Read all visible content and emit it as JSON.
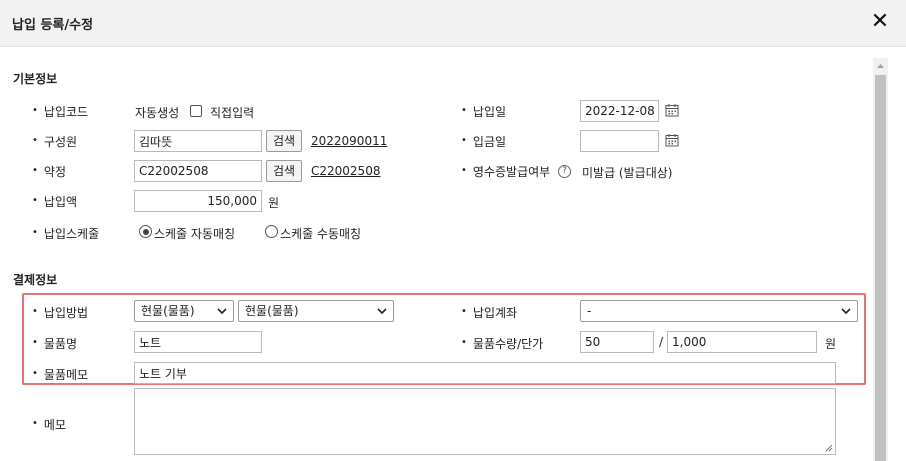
{
  "dialog": {
    "title": "납입 등록/수정",
    "close_label": "✕"
  },
  "sections": {
    "basic": "기본정보",
    "payment": "결제정보"
  },
  "basic": {
    "payment_code_label": "납입코드",
    "auto_gen_text": "자동생성",
    "direct_input_text": "직접입력",
    "member_label": "구성원",
    "member_value": "김따뜻",
    "member_search": "검색",
    "member_link": "2022090011",
    "pledge_label": "약정",
    "pledge_value": "C22002508",
    "pledge_search": "검색",
    "pledge_link": "C22002508",
    "amount_label": "납입액",
    "amount_value": "150,000",
    "amount_unit": "원",
    "schedule_label": "납입스케줄",
    "schedule_auto": "스케줄 자동매칭",
    "schedule_manual": "스케줄 수동매칭",
    "payment_date_label": "납입일",
    "payment_date_value": "2022-12-08",
    "deposit_date_label": "입금일",
    "deposit_date_value": "",
    "receipt_label": "영수증발급여부",
    "receipt_value": "미발급 (발급대상)"
  },
  "payment": {
    "method_label": "납입방법",
    "method_value_1": "현물(물품)",
    "method_value_2": "현물(물품)",
    "account_label": "납입계좌",
    "account_value": "-",
    "item_name_label": "물품명",
    "item_name_value": "노트",
    "qty_price_label": "물품수량/단가",
    "qty_value": "50",
    "separator": "/",
    "price_value": "1,000",
    "price_unit": "원",
    "item_memo_label": "물품메모",
    "item_memo_value": "노트 기부",
    "memo_label": "메모"
  },
  "icons": {
    "calendar": "calendar-icon",
    "help": "help-icon",
    "chevron": "chevron-down-icon"
  },
  "colors": {
    "highlight": "#e57373",
    "titlebar": "#f2f2f2"
  }
}
